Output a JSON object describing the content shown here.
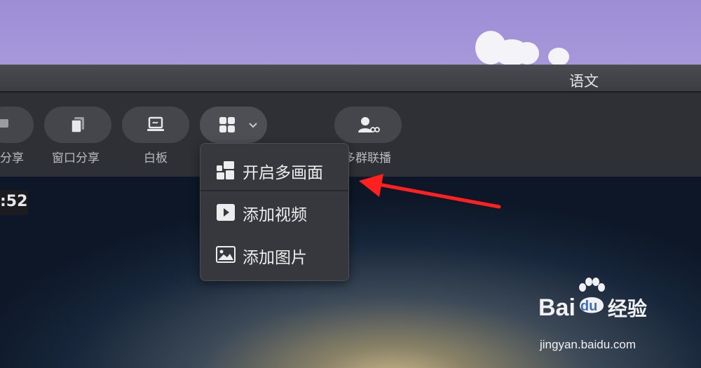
{
  "window": {
    "title": "语文"
  },
  "toolbar": {
    "items": [
      {
        "label": "分享",
        "icon": "screen-share-icon"
      },
      {
        "label": "窗口分享",
        "icon": "window-share-icon"
      },
      {
        "label": "白板",
        "icon": "whiteboard-icon"
      },
      {
        "label": "",
        "icon": "grid-layout-icon"
      },
      {
        "label": "多群联播",
        "icon": "multi-group-broadcast-icon"
      }
    ]
  },
  "timer": ":52",
  "menu": {
    "items": [
      {
        "label": "开启多画面",
        "icon": "grid-icon"
      },
      {
        "label": "添加视频",
        "icon": "video-play-icon"
      },
      {
        "label": "添加图片",
        "icon": "image-icon"
      }
    ]
  },
  "watermark": {
    "brand_left": "Bai",
    "brand_mid": "du",
    "brand_right": "经验",
    "url": "jingyan.baidu.com"
  },
  "colors": {
    "annotation_arrow": "#ff2020",
    "menu_bg": "#37383d"
  }
}
